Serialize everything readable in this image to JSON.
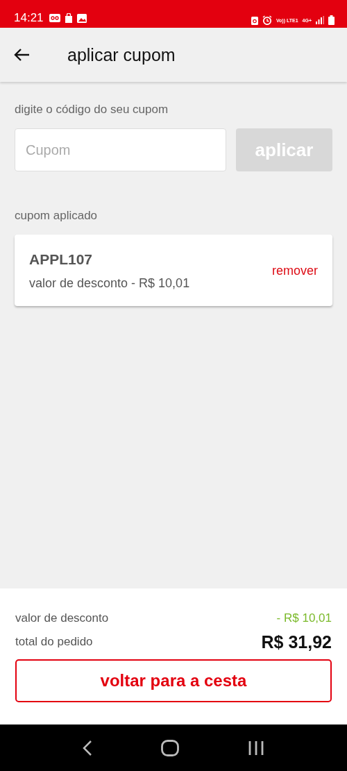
{
  "status_bar": {
    "time": "14:21",
    "network_label": "Vo)) LTE1",
    "network_type": "4G+"
  },
  "header": {
    "title": "aplicar cupom"
  },
  "coupon_entry": {
    "label": "digite o código do seu cupom",
    "placeholder": "Cupom",
    "button": {
      "label": "aplicar",
      "disabled": true
    }
  },
  "applied": {
    "label": "cupom aplicado",
    "code": "APPL107",
    "description": "valor de desconto - R$ 10,01",
    "remove": "remover"
  },
  "summary": [
    {
      "kind": "discount",
      "label": "valor de desconto",
      "value": "- R$ 10,01"
    },
    {
      "kind": "total",
      "label": "total do pedido",
      "value": "R$ 31,92"
    }
  ],
  "footer_button": "voltar para a cesta"
}
